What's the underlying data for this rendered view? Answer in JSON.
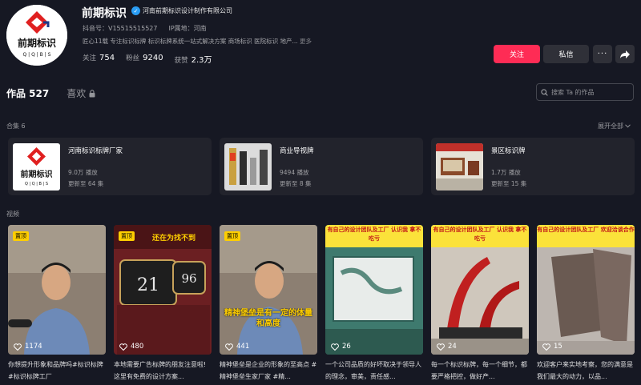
{
  "profile": {
    "name": "前期标识",
    "verify_text": "河南前期标识设计制作有限公司",
    "douyin_id": "抖音号：V15515515527",
    "ip_location": "IP属地：河南",
    "bio": "匠心11载 专注标识标牌 标识标牌系统一站式解决方案 商场标识 医院标识 地产...",
    "bio_more": "更多",
    "logo_text": "前期标识",
    "logo_letters": "Q | Q | B | S",
    "stats": [
      {
        "label": "关注",
        "value": "754"
      },
      {
        "label": "粉丝",
        "value": "9240"
      },
      {
        "label": "获赞",
        "value": "2.3万"
      }
    ]
  },
  "actions": {
    "follow": "关注",
    "message": "私信",
    "more": "···"
  },
  "tabs": {
    "works": "作品 527",
    "likes": "喜欢"
  },
  "search": {
    "placeholder": "搜索 Ta 的作品"
  },
  "collections_label": "合集 6",
  "expand_all": "展开全部",
  "collections": [
    {
      "title": "河南标识标牌厂家",
      "plays": "9.0万 播放",
      "updates": "更新至 64 集"
    },
    {
      "title": "商业导视牌",
      "plays": "9494 播放",
      "updates": "更新至 8 集"
    },
    {
      "title": "景区标识牌",
      "plays": "1.7万 播放",
      "updates": "更新至 15 集"
    }
  ],
  "videos_label": "视频",
  "videos": [
    {
      "pinned": "置顶",
      "likes": "1174",
      "overlay": "",
      "caption": "你想提升形象和品牌吗#标识标牌 #标识标牌工厂"
    },
    {
      "pinned": "置顶",
      "likes": "480",
      "overlay": "还在为找不到",
      "numbers": [
        "21",
        "96"
      ],
      "caption": "本地需要广告标牌的朋友注意啦! 这里有免费的设计方案..."
    },
    {
      "pinned": "置顶",
      "likes": "441",
      "overlay": "精神堡垒是有一定的体量和高度",
      "caption": "精神堡垒是企业的形象的至高点 #精神堡垒生家厂家 #精..."
    },
    {
      "pinned": "",
      "likes": "26",
      "overlay": "有自己的设计团队及工厂 认识我 拿不吃亏",
      "caption": "一个公司品质的好坏取决于领导人的理念，审美，责任感..."
    },
    {
      "pinned": "",
      "likes": "24",
      "overlay": "有自己的设计团队及工厂 认识我 拿不吃亏",
      "caption": "每一个标识标牌，每一个细节，都要严格把控，做好产..."
    },
    {
      "pinned": "",
      "likes": "15",
      "overlay": "有自己的设计团队及工厂 欢迎洽谈合作",
      "caption": "欢迎客户来实地考察，您的满意是我们最大的动力，以品..."
    }
  ]
}
